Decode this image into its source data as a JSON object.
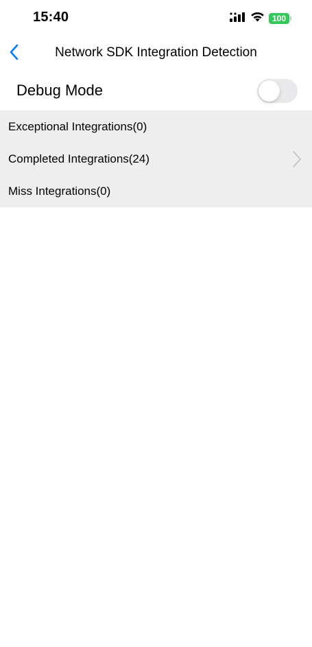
{
  "status_bar": {
    "time": "15:40",
    "battery_level": "100",
    "battery_color": "#34c759",
    "icons": [
      "cellular-signal-icon",
      "wifi-icon",
      "battery-icon"
    ]
  },
  "nav": {
    "back_icon": "chevron-left-icon",
    "title": "Network SDK Integration Detection",
    "accent_color": "#007aff"
  },
  "debug": {
    "label": "Debug Mode",
    "enabled": false
  },
  "list": {
    "items": [
      {
        "label": "Exceptional Integrations(0)",
        "has_chevron": false
      },
      {
        "label": "Completed Integrations(24)",
        "has_chevron": true
      },
      {
        "label": "Miss Integrations(0)",
        "has_chevron": false
      }
    ]
  }
}
